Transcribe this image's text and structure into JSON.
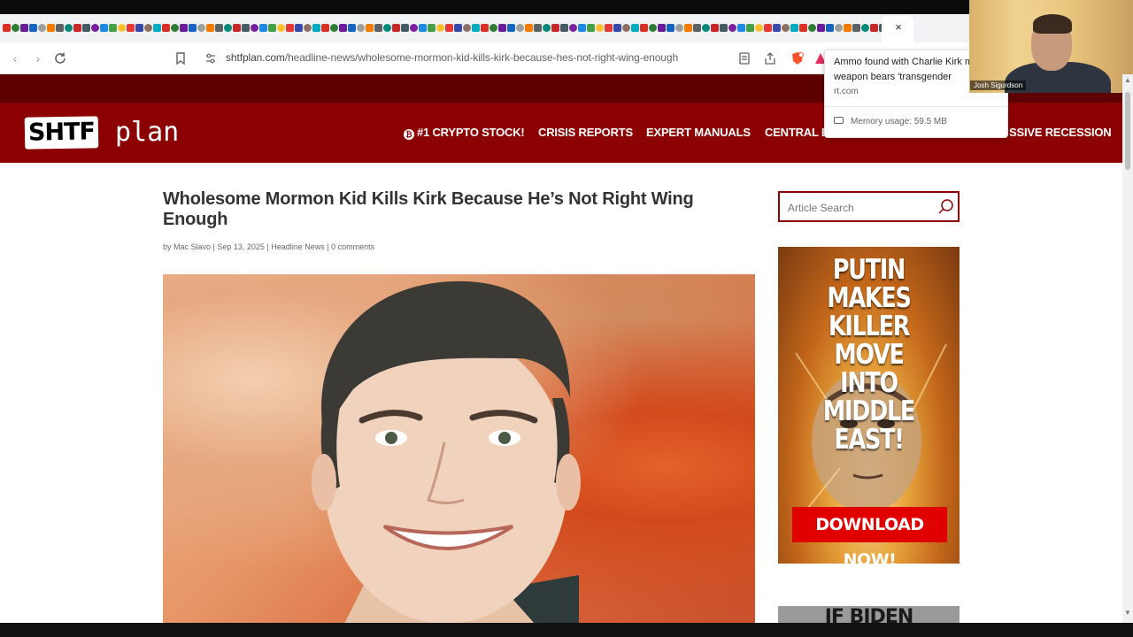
{
  "browser": {
    "url_domain": "shtfplan.com",
    "url_path": "/headline-news/wholesome-mormon-kid-kills-kirk-because-hes-not-right-wing-enough",
    "tab_icon_colors": [
      "#d93025",
      "#2e7d32",
      "#6a1b9a",
      "#1565c0",
      "#9e9e9e",
      "#f57c00",
      "#5f6368",
      "#00897b",
      "#c62828",
      "#455a64",
      "#7b1fa2",
      "#1e88e5",
      "#43a047",
      "#fbc02d",
      "#e53935",
      "#3949ab",
      "#8d6e63",
      "#00acc1"
    ],
    "close_glyph": "×"
  },
  "popup": {
    "title": "Ammo found with Charlie Kirk murder weapon bears 'transgender",
    "domain": "rt.com",
    "memory": "Memory usage: 59.5 MB"
  },
  "webcam": {
    "name": "Josh Sigurdson"
  },
  "site": {
    "logo_left": "SHTF",
    "logo_right": "plan",
    "nav": [
      "#1 CRYPTO STOCK!",
      "CRISIS REPORTS",
      "EXPERT MANUALS",
      "CENTRAL B",
      "SSIVE RECESSION"
    ],
    "brand_color": "#8c0202"
  },
  "article": {
    "title": "Wholesome Mormon Kid Kills Kirk Because He’s Not Right Wing Enough",
    "meta": "by Mac Slavo | Sep 13, 2025 | Headline News | 0 comments"
  },
  "sidebar": {
    "search_placeholder": "Article Search",
    "ad1_lines": [
      "PUTIN MAKES",
      "KILLER MOVE",
      "INTO",
      "MIDDLE EAST!"
    ],
    "ad1_cta": "DOWNLOAD NOW!",
    "ad2_headline": "IF BIDEN IGNORES"
  }
}
